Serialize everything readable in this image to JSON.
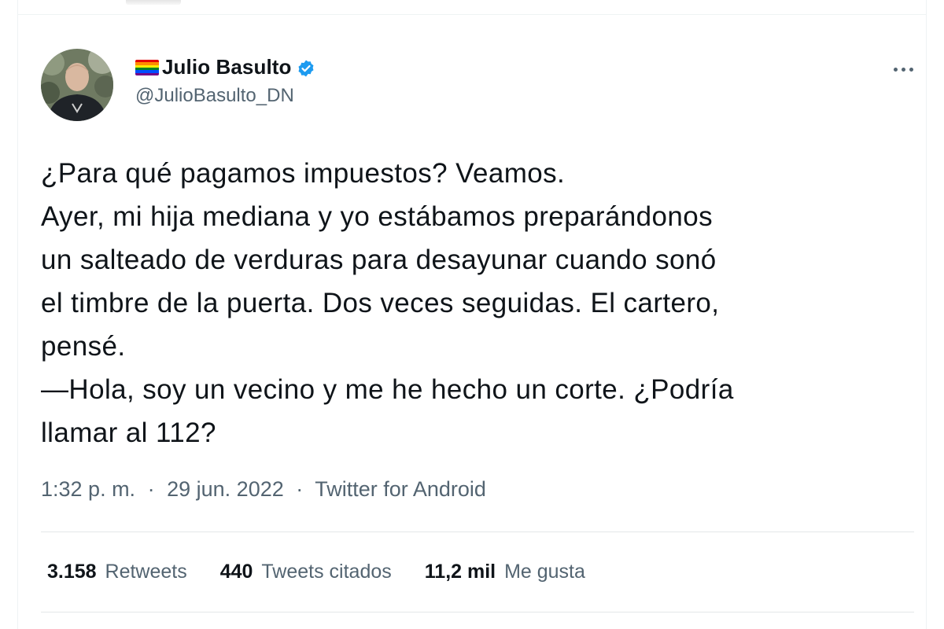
{
  "author": {
    "flag_icon": "rainbow-flag-icon",
    "display_name": "Julio Basulto",
    "verified_icon": "verified-badge-icon",
    "handle": "@JulioBasulto_DN",
    "avatar_icon": "profile-photo"
  },
  "more_icon": "more-options-icon",
  "tweet": {
    "lines": [
      "¿Para qué pagamos impuestos? Veamos.",
      "Ayer, mi hija mediana y yo estábamos preparándonos",
      "un salteado de verduras para desayunar cuando sonó",
      "el timbre de la puerta. Dos veces seguidas. El cartero,",
      "pensé.",
      "—Hola, soy un vecino y me he hecho un corte. ¿Podría",
      "llamar al 112?"
    ]
  },
  "meta": {
    "time": "1:32 p. m.",
    "separator": "·",
    "date": "29 jun. 2022",
    "source": "Twitter for Android"
  },
  "stats": {
    "retweets_count": "3.158",
    "retweets_label": "Retweets",
    "quotes_count": "440",
    "quotes_label": "Tweets citados",
    "likes_count": "11,2 mil",
    "likes_label": "Me gusta"
  },
  "colors": {
    "text_primary": "#0f1419",
    "text_secondary": "#536471",
    "verified_blue": "#1d9bf0",
    "divider": "#eff3f4"
  }
}
